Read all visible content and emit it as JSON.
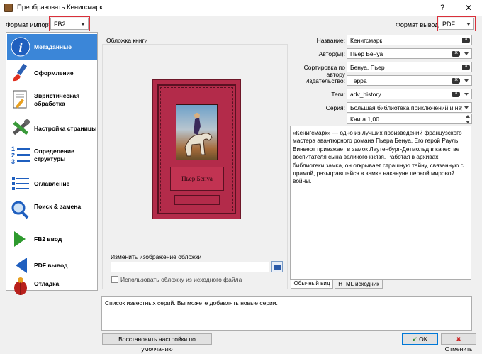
{
  "window": {
    "title": "Преобразовать Кенигсмарк",
    "help": "?",
    "close": "✕"
  },
  "formats": {
    "input_label": "Формат импорта:",
    "input_value": "FB2",
    "output_label": "Формат вывода:",
    "output_value": "PDF"
  },
  "sidebar": {
    "items": [
      {
        "label": "Метаданные",
        "icon": "info-icon"
      },
      {
        "label": "Оформление",
        "icon": "paintbrush-icon"
      },
      {
        "label": "Эвристическая обработка",
        "icon": "document-wand-icon"
      },
      {
        "label": "Настройка страницы",
        "icon": "tools-icon"
      },
      {
        "label": "Определение структуры",
        "icon": "numbered-list-icon"
      },
      {
        "label": "Оглавление",
        "icon": "toc-icon"
      },
      {
        "label": "Поиск & замена",
        "icon": "magnifier-icon"
      },
      {
        "label": "FB2 ввод",
        "icon": "arrow-right-icon"
      },
      {
        "label": "PDF вывод",
        "icon": "arrow-left-icon"
      },
      {
        "label": "Отладка",
        "icon": "bug-icon"
      }
    ],
    "selected_index": 0
  },
  "cover": {
    "group_title": "Обложка книги",
    "book_author": "Пьер Бенуа",
    "change_label": "Изменить изображение обложки",
    "path_value": "",
    "use_source_label": "Использовать обложку из исходного файла",
    "use_source_checked": false
  },
  "metadata": {
    "title_label": "Название:",
    "title_value": "Кенигсмарк",
    "author_label": "Автор(ы):",
    "author_value": "Пьер Бенуа",
    "sort_label": "Сортировка по автору",
    "sort_value": "Бенуа, Пьер",
    "publisher_label": "Издательство:",
    "publisher_value": "Терра",
    "tags_label": "Теги:",
    "tags_value": "adv_history",
    "series_label": "Серия:",
    "series_value": "Большая библиотека приключений и нау",
    "book_number": "Книга 1,00",
    "comments": "«Кенигсмарк» — одно из лучших произведений французского мастера авантюрного романа Пьера Бенуа. Его герой Рауль Винверт приезжает в замок Лаутенбург-Детмольд в качестве воспитателя сына великого князя. Работая в архивах библиотеки замка, он открывает страшную тайну, связанную с драмой, разыгравшейся в замке накануне первой мировой войны."
  },
  "tabs": {
    "normal": "Обычный вид",
    "html": "HTML исходник"
  },
  "series_help": "Список известных серий. Вы можете добавлять новые серии.",
  "buttons": {
    "restore": "Восстановить настройки по умолчанию",
    "ok": "OK",
    "cancel": "Отменить"
  },
  "colors": {
    "selection": "#3b86d8",
    "highlight_border": "#d9303a",
    "book_cover": "#b32b4a"
  }
}
